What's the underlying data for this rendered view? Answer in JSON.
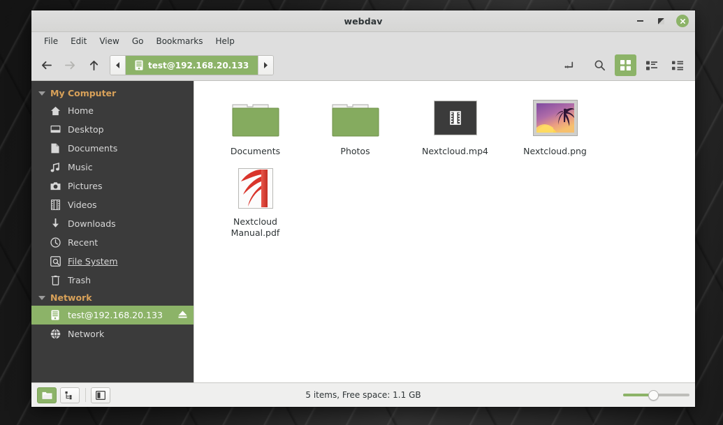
{
  "window": {
    "title": "webdav",
    "controls": {
      "minimize": "–",
      "maximize": "□",
      "close": "✕"
    }
  },
  "menubar": {
    "items": [
      {
        "label": "File"
      },
      {
        "label": "Edit"
      },
      {
        "label": "View"
      },
      {
        "label": "Go"
      },
      {
        "label": "Bookmarks"
      },
      {
        "label": "Help"
      }
    ]
  },
  "toolbar": {
    "back_tooltip": "Back",
    "forward_tooltip": "Forward",
    "up_tooltip": "Open parent folder",
    "pathbar": {
      "scroll_left": "◀",
      "scroll_right": "▶",
      "crumb": "test@192.168.20.133",
      "crumb_icon": "server-icon"
    },
    "right_buttons": [
      {
        "name": "toggle-location-entry-icon",
        "label": "Toggle path entry",
        "active": false
      },
      {
        "name": "search-icon",
        "label": "Search",
        "active": false
      },
      {
        "name": "icon-view-icon",
        "label": "Icon view",
        "active": true
      },
      {
        "name": "list-view-icon",
        "label": "List view",
        "active": false
      },
      {
        "name": "compact-view-icon",
        "label": "Compact view",
        "active": false
      }
    ]
  },
  "sidebar": {
    "groups": [
      {
        "label": "My Computer",
        "items": [
          {
            "label": "Home",
            "icon": "home-icon",
            "selected": false,
            "underlined": false,
            "eject": false
          },
          {
            "label": "Desktop",
            "icon": "desktop-icon",
            "selected": false,
            "underlined": false,
            "eject": false
          },
          {
            "label": "Documents",
            "icon": "document-icon",
            "selected": false,
            "underlined": false,
            "eject": false
          },
          {
            "label": "Music",
            "icon": "music-note-icon",
            "selected": false,
            "underlined": false,
            "eject": false
          },
          {
            "label": "Pictures",
            "icon": "camera-icon",
            "selected": false,
            "underlined": false,
            "eject": false
          },
          {
            "label": "Videos",
            "icon": "film-icon",
            "selected": false,
            "underlined": false,
            "eject": false
          },
          {
            "label": "Downloads",
            "icon": "download-arrow-icon",
            "selected": false,
            "underlined": false,
            "eject": false
          },
          {
            "label": "Recent",
            "icon": "clock-icon",
            "selected": false,
            "underlined": false,
            "eject": false
          },
          {
            "label": "File System",
            "icon": "harddisk-icon",
            "selected": false,
            "underlined": true,
            "eject": false
          },
          {
            "label": "Trash",
            "icon": "trash-icon",
            "selected": false,
            "underlined": false,
            "eject": false
          }
        ]
      },
      {
        "label": "Network",
        "items": [
          {
            "label": "test@192.168.20.133",
            "icon": "server-icon",
            "selected": true,
            "underlined": false,
            "eject": true
          },
          {
            "label": "Network",
            "icon": "globe-icon",
            "selected": false,
            "underlined": false,
            "eject": false
          }
        ]
      }
    ]
  },
  "files": [
    {
      "name": "Documents",
      "icon": "folder-icon"
    },
    {
      "name": "Photos",
      "icon": "folder-icon"
    },
    {
      "name": "Nextcloud.mp4",
      "icon": "video-file-icon"
    },
    {
      "name": "Nextcloud.png",
      "icon": "image-thumbnail-icon"
    },
    {
      "name": "Nextcloud Manual.pdf",
      "icon": "pdf-file-icon"
    }
  ],
  "statusbar": {
    "buttons": [
      {
        "name": "icon-view-toggle",
        "label": "Icon view",
        "active": true
      },
      {
        "name": "tree-view-toggle",
        "label": "Tree view",
        "active": false
      },
      {
        "name": "show-sidebar-toggle",
        "label": "Toggle sidebar",
        "active": false
      }
    ],
    "status": "5 items, Free space: 1.1 GB",
    "zoom": {
      "label": "Zoom",
      "value": 40
    }
  },
  "colors": {
    "accent_green": "#8cb368",
    "sidebar_bg": "#3b3b3b",
    "chrome_bg": "#dedede",
    "content_bg": "#ffffff",
    "folder_green": "#85ab5f",
    "pdf_red": "#d9342b"
  }
}
